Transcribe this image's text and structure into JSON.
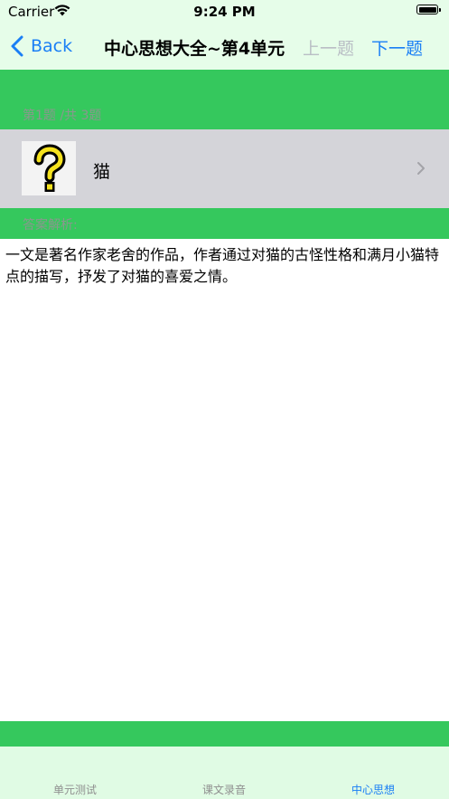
{
  "status_bar": {
    "carrier": "Carrier",
    "time": "9:24 PM"
  },
  "nav": {
    "back_label": "Back",
    "title": "中心思想大全~第4单元",
    "prev_label": "上一题",
    "next_label": "下一题"
  },
  "question": {
    "index_text": "第1题 /共 3题",
    "label": "猫",
    "icon": "question-mark-icon"
  },
  "answer": {
    "heading": "答案解析:",
    "text": "一文是著名作家老舍的作品，作者通过对猫的古怪性格和满月小猫特点的描写，抒发了对猫的喜爱之情。"
  },
  "tabs": [
    {
      "label": "单元测试",
      "active": false
    },
    {
      "label": "课文录音",
      "active": false
    },
    {
      "label": "中心思想",
      "active": true
    }
  ],
  "colors": {
    "green": "#35c85d",
    "light_green": "#e6fde9",
    "accent_blue": "#1a7ff5",
    "disabled_gray": "#b9bec5",
    "cell_gray": "#d4d4d9"
  }
}
